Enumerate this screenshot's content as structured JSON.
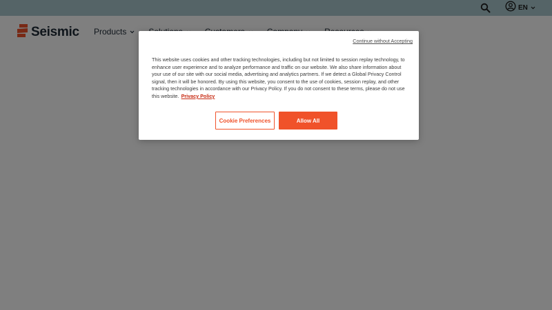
{
  "header": {
    "logo_text": "Seismic",
    "language": "EN",
    "nav": [
      {
        "label": "Products"
      },
      {
        "label": "Solutions"
      },
      {
        "label": "Customers"
      },
      {
        "label": "Company"
      },
      {
        "label": "Resources"
      }
    ]
  },
  "cookie_banner": {
    "continue_label": "Continue without Accepting",
    "body_text": "This website uses cookies and other tracking technologies, including but not limited to session replay technology, to enhance user experience and to analyze performance and traffic on our website. We also share information about your use of our site with our social media, advertising and analytics partners. If we detect a Global Privacy Control signal, then it will be honored. By using this website, you consent to the use of cookies, session replay, and other tracking technologies in accordance with our Privacy Policy. If you do not consent to these terms, please do not use this website.",
    "privacy_link": "Privacy Policy",
    "preferences_label": "Cookie Preferences",
    "allow_label": "Allow All"
  },
  "colors": {
    "utility_bar": "#abc9cf",
    "brand_orange": "#f0522a",
    "logo_navy": "#1e2a37"
  },
  "icons": {
    "search": "search-icon",
    "account": "user-circle-icon",
    "dropdown": "chevron-down-icon",
    "logo": "seismic-logo-icon"
  }
}
